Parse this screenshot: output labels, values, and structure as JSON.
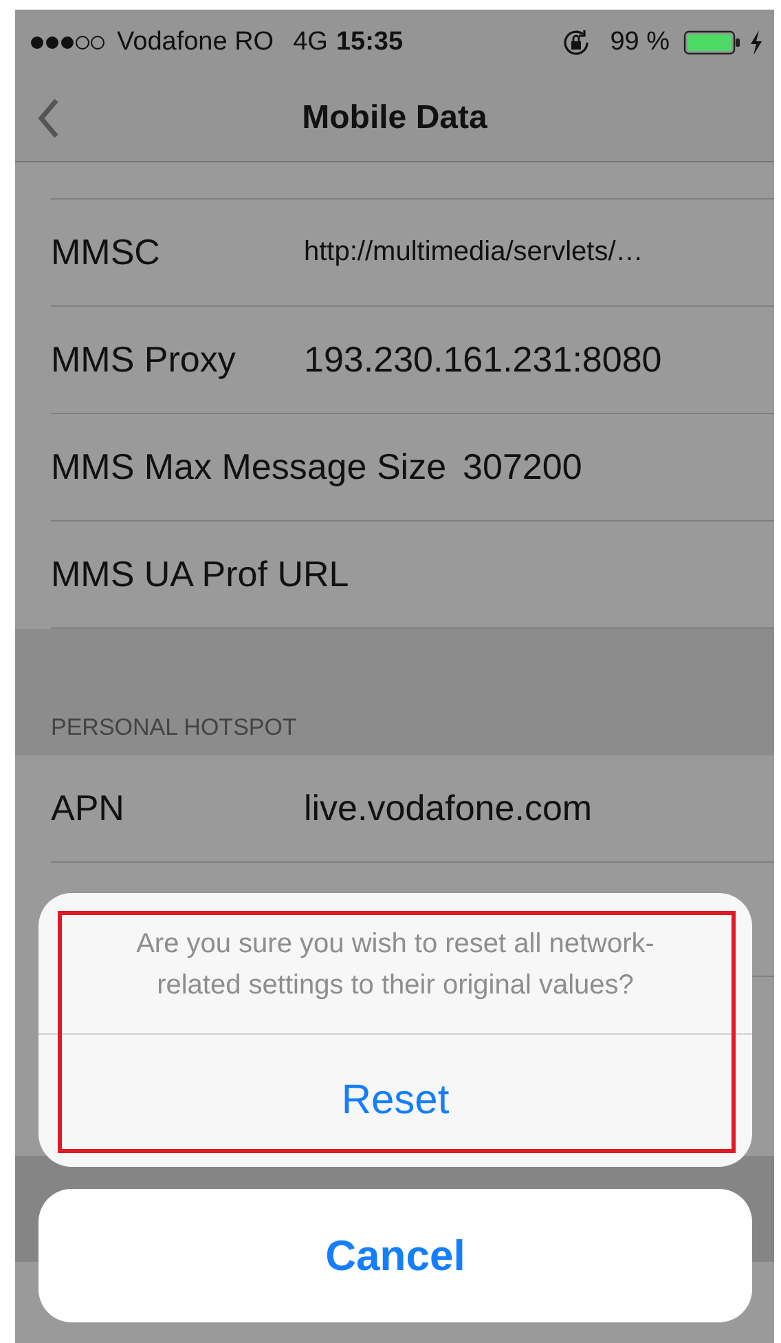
{
  "status_bar": {
    "carrier": "Vodafone RO",
    "network": "4G",
    "time": "15:35",
    "battery": "99 %"
  },
  "nav": {
    "title": "Mobile Data"
  },
  "sections": [
    {
      "rows": [
        {
          "label": "MMSC",
          "value": "http://multimedia/servlets/…",
          "kind": "small"
        },
        {
          "label": "MMS Proxy",
          "value": "193.230.161.231:8080",
          "kind": "normal"
        },
        {
          "label": "MMS Max Message Size",
          "value": "307200",
          "kind": "normal"
        },
        {
          "label": "MMS UA Prof URL",
          "kind": "normal"
        }
      ]
    },
    {
      "header": "PERSONAL HOTSPOT",
      "rows": [
        {
          "label": "APN",
          "value": "live.vodafone.com",
          "kind": "normal"
        }
      ]
    }
  ],
  "alert": {
    "message": "Are you sure you wish to reset all network-related settings to their original values?",
    "highlighted": true,
    "actions": [
      {
        "label": "Reset"
      }
    ]
  },
  "cancel": {
    "label": "Cancel"
  }
}
